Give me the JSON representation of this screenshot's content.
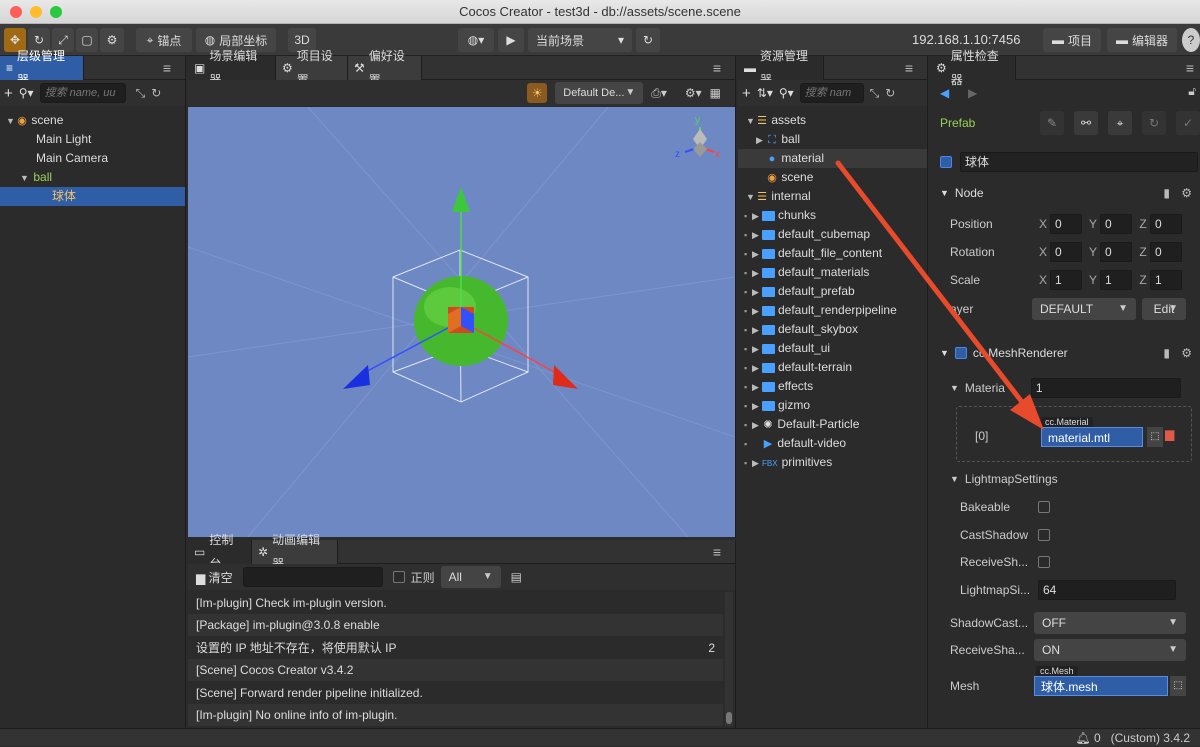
{
  "window": {
    "title": "Cocos Creator - test3d - db://assets/scene.scene"
  },
  "toolbar": {
    "anchor_label": "锚点",
    "coord_label": "局部坐标",
    "mode_3d": "3D",
    "scene_select": "当前场景",
    "ip": "192.168.1.10:7456",
    "project_btn": "项目",
    "editor_btn": "编辑器"
  },
  "hierarchy": {
    "tab": "层级管理器",
    "search_placeholder": "搜索 name, uu",
    "items": [
      {
        "label": "scene"
      },
      {
        "label": "Main Light"
      },
      {
        "label": "Main Camera"
      },
      {
        "label": "ball"
      },
      {
        "label": "球体"
      }
    ]
  },
  "scene": {
    "tabs": [
      "场景编辑器",
      "项目设置",
      "偏好设置"
    ],
    "camera_select": "Default De...",
    "gizmo": {
      "x": "x",
      "y": "y",
      "z": "z"
    }
  },
  "assets": {
    "tab": "资源管理器",
    "search_placeholder": "搜索 nam",
    "items": [
      {
        "label": "assets"
      },
      {
        "label": "ball"
      },
      {
        "label": "material"
      },
      {
        "label": "scene"
      },
      {
        "label": "internal"
      },
      {
        "label": "chunks"
      },
      {
        "label": "default_cubemap"
      },
      {
        "label": "default_file_content"
      },
      {
        "label": "default_materials"
      },
      {
        "label": "default_prefab"
      },
      {
        "label": "default_renderpipeline"
      },
      {
        "label": "default_skybox"
      },
      {
        "label": "default_ui"
      },
      {
        "label": "default-terrain"
      },
      {
        "label": "effects"
      },
      {
        "label": "gizmo"
      },
      {
        "label": "Default-Particle"
      },
      {
        "label": "default-video"
      },
      {
        "label": "primitives",
        "tag": "FBX"
      }
    ]
  },
  "inspector": {
    "tab": "属性检查器",
    "prefab_label": "Prefab",
    "node_name": "球体",
    "node_section": "Node",
    "position": {
      "label": "Position",
      "x": "0",
      "y": "0",
      "z": "0"
    },
    "rotation": {
      "label": "Rotation",
      "x": "0",
      "y": "0",
      "z": "0"
    },
    "scale": {
      "label": "Scale",
      "x": "1",
      "y": "1",
      "z": "1"
    },
    "axes": {
      "x": "X",
      "y": "Y",
      "z": "Z"
    },
    "layer": {
      "label": "ayer",
      "value": "DEFAULT",
      "edit": "Edit"
    },
    "mesh_renderer": "cc.MeshRenderer",
    "materials": {
      "label": "Materia",
      "count": "1",
      "index": "[0]",
      "type": "cc.Material",
      "value": "material.mtl"
    },
    "lightmap": {
      "title": "LightmapSettings",
      "bakeable": "Bakeable",
      "cast_shadow": "CastShadow",
      "receive_shadow": "ReceiveSh...",
      "lightmap_size_label": "LightmapSi...",
      "lightmap_size": "64"
    },
    "shadow_casting": {
      "label": "ShadowCast...",
      "value": "OFF"
    },
    "receive_shadow": {
      "label": "ReceiveSha...",
      "value": "ON"
    },
    "mesh": {
      "label": "Mesh",
      "type": "cc.Mesh",
      "value": "球体.mesh"
    }
  },
  "console": {
    "tabs": [
      "控制台",
      "动画编辑器"
    ],
    "clear": "清空",
    "regex": "正则",
    "filter": "All",
    "lines": [
      {
        "text": "[Im-plugin] Check im-plugin version.",
        "count": ""
      },
      {
        "text": "[Package] im-plugin@3.0.8 enable",
        "count": ""
      },
      {
        "text": "设置的 IP 地址不存在，将使用默认 IP",
        "count": "2"
      },
      {
        "text": "[Scene] Cocos Creator v3.4.2",
        "count": ""
      },
      {
        "text": "[Scene] Forward render pipeline initialized.",
        "count": ""
      },
      {
        "text": "[Im-plugin] No online info of im-plugin.",
        "count": ""
      }
    ]
  },
  "status": {
    "notifications": "0",
    "version": "(Custom) 3.4.2"
  },
  "colors": {
    "selection": "#2f5ea6",
    "accent": "#4aa0ff",
    "scene_bg": "#6e88c4",
    "arrow": "#e84a2c"
  }
}
